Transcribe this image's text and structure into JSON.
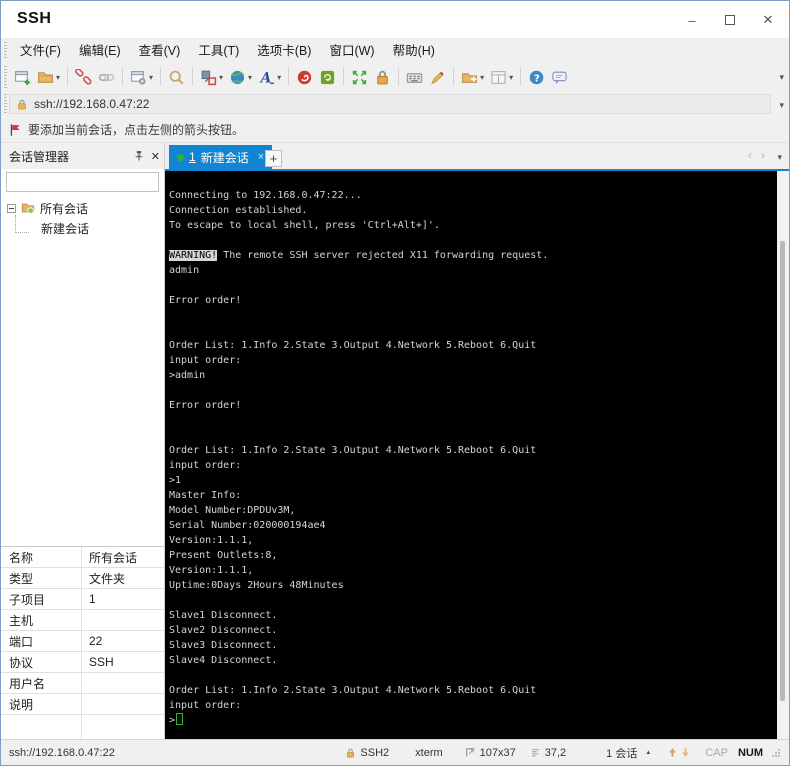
{
  "window": {
    "title": "SSH",
    "minimize_glyph": "–",
    "close_glyph": "✕"
  },
  "menu": {
    "items": [
      {
        "name": "file",
        "label": "文件(F)"
      },
      {
        "name": "edit",
        "label": "编辑(E)"
      },
      {
        "name": "view",
        "label": "查看(V)"
      },
      {
        "name": "tools",
        "label": "工具(T)"
      },
      {
        "name": "tab",
        "label": "选项卡(B)"
      },
      {
        "name": "window",
        "label": "窗口(W)"
      },
      {
        "name": "help",
        "label": "帮助(H)"
      }
    ]
  },
  "toolbar": {
    "overflow_glyph": "▾",
    "caret_glyph": "▾",
    "buttons": [
      {
        "icon": "new-session"
      },
      {
        "icon": "open-folder",
        "caret": true
      },
      {
        "sep": true
      },
      {
        "icon": "disconnect"
      },
      {
        "icon": "reconnect"
      },
      {
        "sep": true
      },
      {
        "icon": "session-properties",
        "caret": true
      },
      {
        "sep": true
      },
      {
        "icon": "find"
      },
      {
        "sep": true
      },
      {
        "icon": "compose",
        "caret": true
      },
      {
        "icon": "web",
        "caret": true
      },
      {
        "icon": "font",
        "caret": true
      },
      {
        "sep": true
      },
      {
        "icon": "zmodem"
      },
      {
        "icon": "sync"
      },
      {
        "sep": true
      },
      {
        "icon": "fullscreen"
      },
      {
        "icon": "lock"
      },
      {
        "sep": true
      },
      {
        "icon": "keyboard"
      },
      {
        "icon": "highlight"
      },
      {
        "sep": true
      },
      {
        "icon": "new-folder",
        "caret": true
      },
      {
        "icon": "layout",
        "caret": true
      },
      {
        "sep": true
      },
      {
        "icon": "help"
      },
      {
        "icon": "feedback"
      }
    ]
  },
  "address_bar": {
    "url": "ssh://192.168.0.47:22",
    "caret_glyph": "▾"
  },
  "notice": {
    "text": "要添加当前会话，点击左侧的箭头按钮。"
  },
  "session_manager": {
    "title": "会话管理器",
    "close_glyph": "✕",
    "root_label": "所有会话",
    "child_label": "新建会话"
  },
  "properties": [
    {
      "name": "name",
      "label": "名称",
      "value": "所有会话"
    },
    {
      "name": "type",
      "label": "类型",
      "value": "文件夹"
    },
    {
      "name": "children",
      "label": "子项目",
      "value": "1"
    },
    {
      "name": "host",
      "label": "主机",
      "value": ""
    },
    {
      "name": "port",
      "label": "端口",
      "value": "22"
    },
    {
      "name": "protocol",
      "label": "协议",
      "value": "SSH"
    },
    {
      "name": "username",
      "label": "用户名",
      "value": ""
    },
    {
      "name": "description",
      "label": "说明",
      "value": ""
    }
  ],
  "tab_bar": {
    "active_tab": {
      "index": "1",
      "label": "新建会话",
      "close_glyph": "×"
    },
    "new_tab_glyph": "+",
    "scroll_left_glyph": "‹",
    "scroll_right_glyph": "›",
    "menu_glyph": "▾"
  },
  "terminal": {
    "lines": [
      "Connecting to 192.168.0.47:22...",
      "Connection established.",
      "To escape to local shell, press 'Ctrl+Alt+]'.",
      "",
      {
        "segments": [
          {
            "text": "WARNING!",
            "style": "inverse"
          },
          {
            "text": " The remote SSH server rejected X11 forwarding request.",
            "style": "normal"
          }
        ]
      },
      "admin",
      "",
      "Error order!",
      "",
      "",
      "Order List: 1.Info 2.State 3.Output 4.Network 5.Reboot 6.Quit",
      "input order:",
      ">admin",
      "",
      "Error order!",
      "",
      "",
      "Order List: 1.Info 2.State 3.Output 4.Network 5.Reboot 6.Quit",
      "input order:",
      ">1",
      "Master Info:",
      "Model Number:DPDUv3M,",
      "Serial Number:020000194ae4",
      "Version:1.1.1,",
      "Present Outlets:8,",
      "Version:1.1.1,",
      "Uptime:0Days 2Hours 48Minutes",
      "",
      "Slave1 Disconnect.",
      "Slave2 Disconnect.",
      "Slave3 Disconnect.",
      "Slave4 Disconnect.",
      "",
      "Order List: 1.Info 2.State 3.Output 4.Network 5.Reboot 6.Quit",
      "input order:",
      {
        "segments": [
          {
            "text": ">",
            "style": "normal"
          },
          {
            "text": "",
            "style": "cursor"
          }
        ]
      }
    ]
  },
  "status_bar": {
    "url": "ssh://192.168.0.47:22",
    "protocol": "SSH2",
    "terminal_type": "xterm",
    "size": "107x37",
    "cursor_position": "37,2",
    "sessions": "1 会话",
    "caps_indicator": "CAP",
    "num_indicator": "NUM"
  },
  "colors": {
    "accent_blue": "#1285d2",
    "terminal_bg": "#000000",
    "terminal_fg": "#d4d4d4",
    "cursor_green": "#33b233",
    "tab_dot_green": "#35b235"
  }
}
